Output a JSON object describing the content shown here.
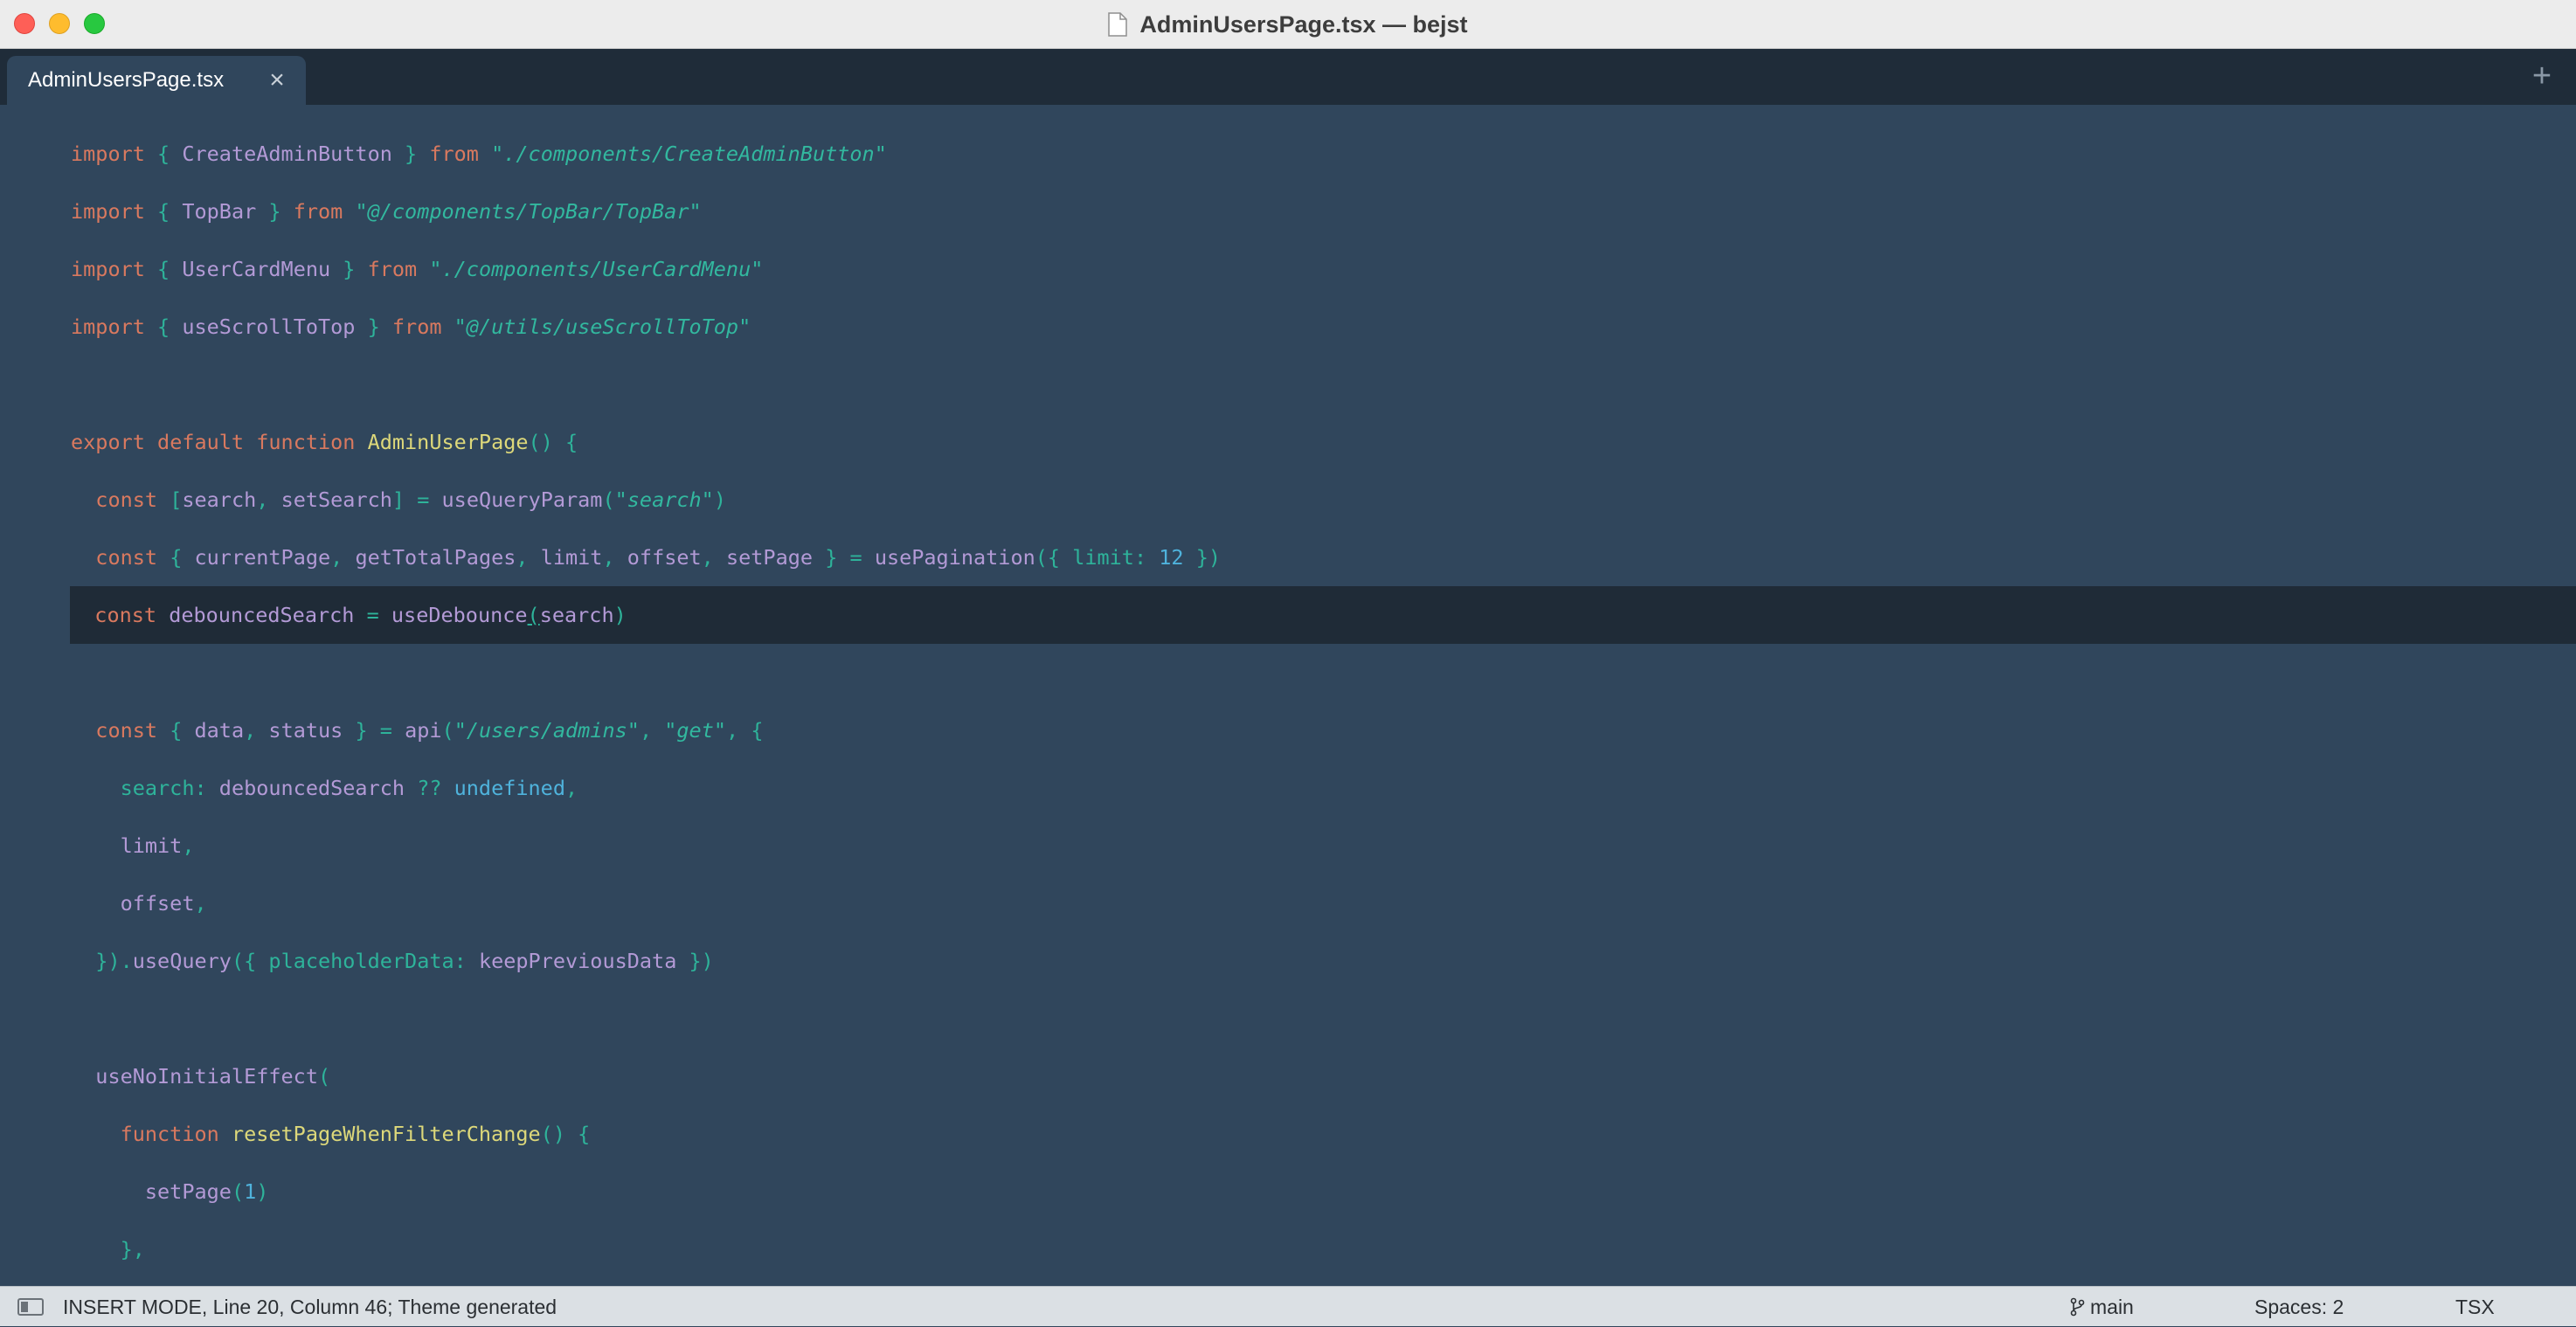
{
  "window": {
    "title": "AdminUsersPage.tsx — bejst"
  },
  "tabs": [
    {
      "label": "AdminUsersPage.tsx",
      "close": "×"
    }
  ],
  "tab_add": "+",
  "editor": {
    "lines": [
      "import { CreateAdminButton } from \"./components/CreateAdminButton\"",
      "import { TopBar } from \"@/components/TopBar/TopBar\"",
      "import { UserCardMenu } from \"./components/UserCardMenu\"",
      "import { useScrollToTop } from \"@/utils/useScrollToTop\"",
      "",
      "export default function AdminUserPage() {",
      "  const [search, setSearch] = useQueryParam(\"search\")",
      "  const { currentPage, getTotalPages, limit, offset, setPage } = usePagination({ limit: 12 })",
      "  const debouncedSearch = useDebounce(search)",
      "",
      "  const { data, status } = api(\"/users/admins\", \"get\", {",
      "    search: debouncedSearch ?? undefined,",
      "    limit,",
      "    offset,",
      "  }).useQuery({ placeholderData: keepPreviousData })",
      "",
      "  useNoInitialEffect(",
      "    function resetPageWhenFilterChange() {",
      "      setPage(1)",
      "    },"
    ],
    "current_line_index": 8
  },
  "statusbar": {
    "mode_text": "INSERT MODE, Line 20, Column 46; Theme generated",
    "branch": "main",
    "spaces": "Spaces: 2",
    "language": "TSX"
  },
  "colors": {
    "editor_bg": "#30465c",
    "current_line_bg": "#1f2b37",
    "keyword": "#d9795f",
    "identifier": "#b39ad6",
    "string": "#32b89f",
    "function_name": "#ddd87a",
    "number": "#4fb3dc"
  }
}
